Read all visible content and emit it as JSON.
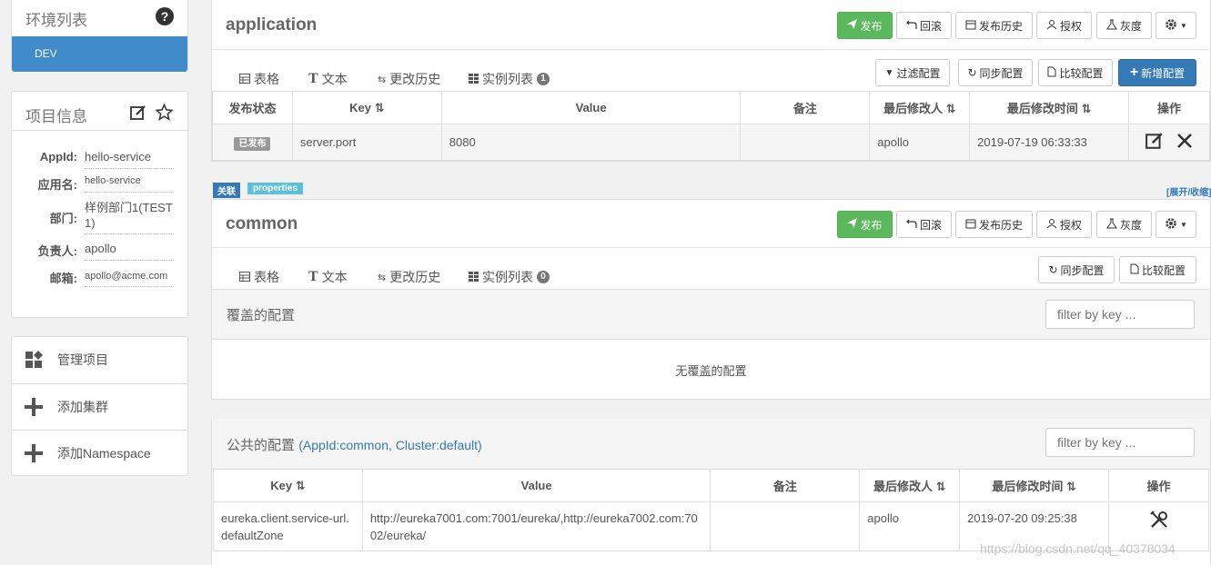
{
  "sidebar": {
    "env_title": "环境列表",
    "env_items": [
      "DEV"
    ],
    "project_title": "项目信息",
    "info": [
      {
        "key": "AppId:",
        "value": "hello-service"
      },
      {
        "key": "应用名:",
        "value": "hello-service"
      },
      {
        "key": "部门:",
        "value": "样例部门1(TEST1)"
      },
      {
        "key": "负责人:",
        "value": "apollo"
      },
      {
        "key": "邮箱:",
        "value": "apollo@acme.com"
      }
    ],
    "actions": [
      "管理项目",
      "添加集群",
      "添加Namespace"
    ]
  },
  "buttons": {
    "publish": "发布",
    "rollback": "回滚",
    "publish_history": "发布历史",
    "authorize": "授权",
    "gray": "灰度",
    "filter_config": "过滤配置",
    "sync_config": "同步配置",
    "compare_config": "比较配置",
    "add_config": "新增配置"
  },
  "tabs": {
    "table": "表格",
    "text": "文本",
    "history": "更改历史",
    "instances": "实例列表"
  },
  "ns1": {
    "title": "application",
    "instance_count": "1",
    "columns": [
      "发布状态",
      "Key",
      "Value",
      "备注",
      "最后修改人",
      "最后修改时间",
      "操作"
    ],
    "rows": [
      {
        "status": "已发布",
        "key": "server.port",
        "value": "8080",
        "comment": "",
        "modifier": "apollo",
        "time": "2019-07-19 06:33:33"
      }
    ]
  },
  "ns2": {
    "tag_associated": "关联",
    "tag_format": "properties",
    "expand_toggle": "[展开/收缩]",
    "title": "common",
    "instance_count": "0",
    "override_title": "覆盖的配置",
    "filter_placeholder": "filter by key ...",
    "override_empty": "无覆盖的配置",
    "public_title": "公共的配置",
    "public_sub": "(AppId:common, Cluster:default)",
    "columns": [
      "Key",
      "Value",
      "备注",
      "最后修改人",
      "最后修改时间",
      "操作"
    ],
    "rows": [
      {
        "key": "eureka.client.service-url.defaultZone",
        "value": "http://eureka7001.com:7001/eureka/,http://eureka7002.com:7002/eureka/",
        "comment": "",
        "modifier": "apollo",
        "time": "2019-07-20 09:25:38"
      }
    ]
  },
  "watermark": "https://blog.csdn.net/qq_40378034"
}
